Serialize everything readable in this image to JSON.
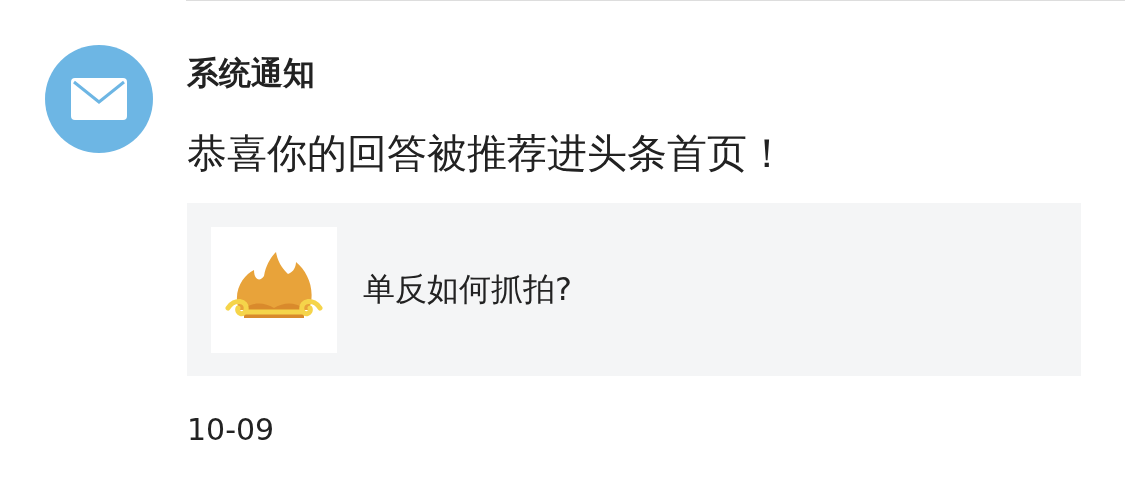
{
  "notification": {
    "sender": "系统通知",
    "message": "恭喜你的回答被推荐进头条首页！",
    "card": {
      "title": "单反如何抓拍?"
    },
    "date": "10-09"
  }
}
